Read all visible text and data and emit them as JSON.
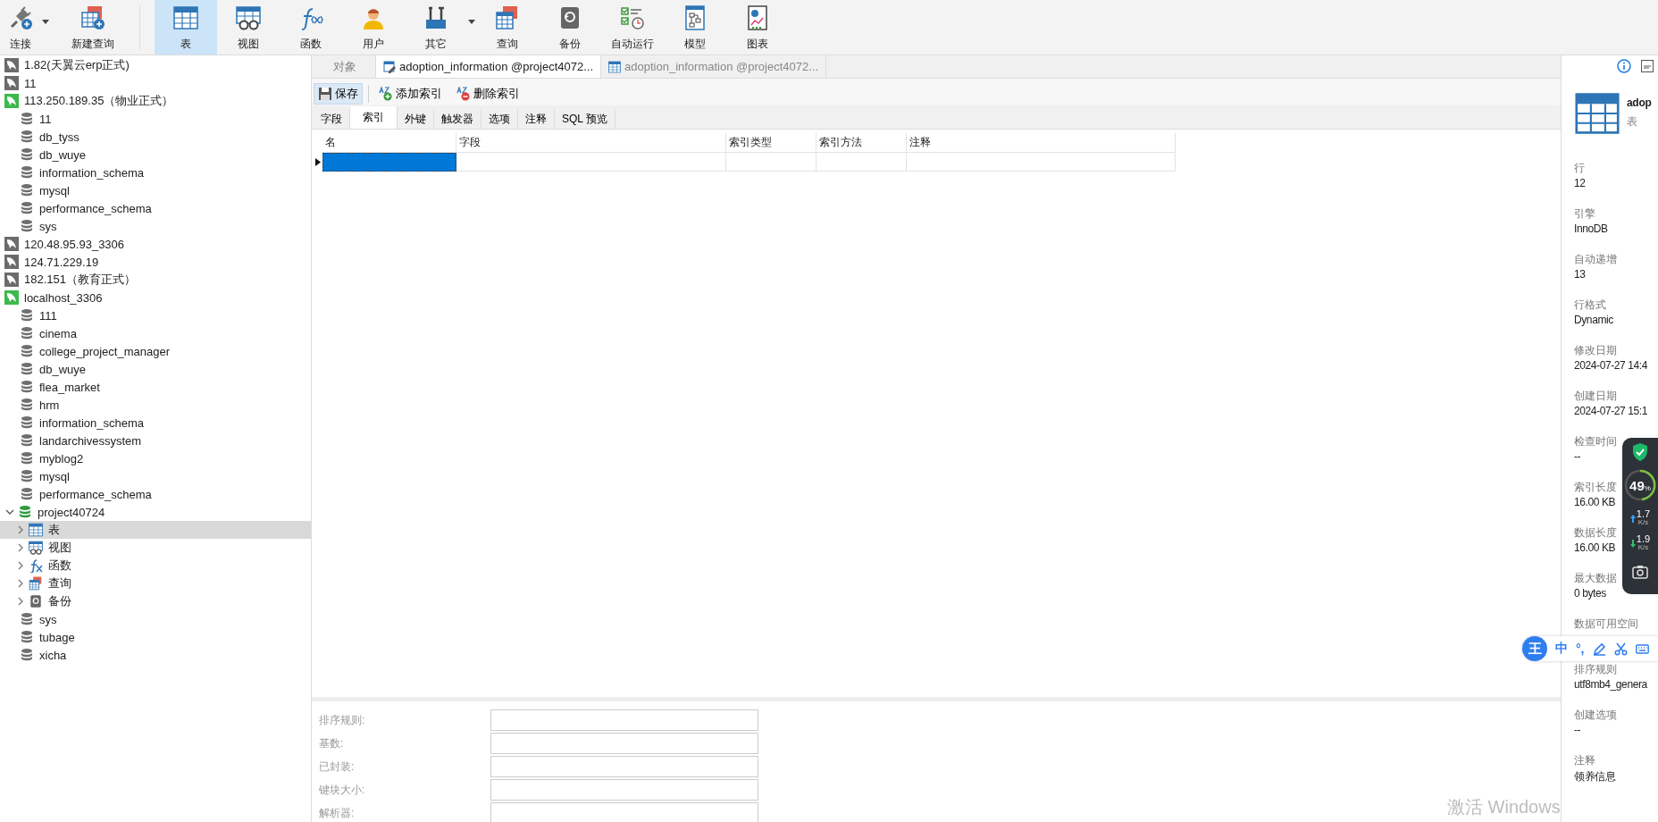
{
  "toolbar": [
    {
      "label": "连接",
      "kind": "plug",
      "dropdown": true,
      "selected": false
    },
    {
      "label": "新建查询",
      "kind": "newquery",
      "separator_after": true,
      "selected": false
    },
    {
      "label": "表",
      "kind": "table",
      "selected": true
    },
    {
      "label": "视图",
      "kind": "view",
      "selected": false
    },
    {
      "label": "函数",
      "kind": "function",
      "selected": false
    },
    {
      "label": "用户",
      "kind": "user",
      "selected": false
    },
    {
      "label": "其它",
      "kind": "tools",
      "dropdown": true,
      "selected": false
    },
    {
      "label": "查询",
      "kind": "query",
      "selected": false
    },
    {
      "label": "备份",
      "kind": "backup",
      "selected": false
    },
    {
      "label": "自动运行",
      "kind": "schedule",
      "selected": false
    },
    {
      "label": "模型",
      "kind": "model",
      "selected": false
    },
    {
      "label": "图表",
      "kind": "chart",
      "selected": false
    }
  ],
  "tree": [
    {
      "label": "1.82(天翼云erp正式)",
      "kind": "connection",
      "open": false,
      "selected": false
    },
    {
      "label": "11",
      "kind": "connection",
      "open": false,
      "selected": false
    },
    {
      "label": "113.250.189.35（物业正式）",
      "kind": "connection",
      "open": true,
      "selected": false,
      "children": [
        {
          "label": "11",
          "kind": "database",
          "open": false,
          "selected": false
        },
        {
          "label": "db_tyss",
          "kind": "database",
          "open": false,
          "selected": false
        },
        {
          "label": "db_wuye",
          "kind": "database",
          "open": false,
          "selected": false
        },
        {
          "label": "information_schema",
          "kind": "database",
          "open": false,
          "selected": false
        },
        {
          "label": "mysql",
          "kind": "database",
          "open": false,
          "selected": false
        },
        {
          "label": "performance_schema",
          "kind": "database",
          "open": false,
          "selected": false
        },
        {
          "label": "sys",
          "kind": "database",
          "open": false,
          "selected": false
        }
      ]
    },
    {
      "label": "120.48.95.93_3306",
      "kind": "connection",
      "open": false,
      "selected": false
    },
    {
      "label": "124.71.229.19",
      "kind": "connection",
      "open": false,
      "selected": false
    },
    {
      "label": "182.151（教育正式）",
      "kind": "connection",
      "open": false,
      "selected": false
    },
    {
      "label": "localhost_3306",
      "kind": "connection",
      "open": true,
      "selected": false,
      "children": [
        {
          "label": "111",
          "kind": "database",
          "open": false,
          "selected": false
        },
        {
          "label": "cinema",
          "kind": "database",
          "open": false,
          "selected": false
        },
        {
          "label": "college_project_manager",
          "kind": "database",
          "open": false,
          "selected": false
        },
        {
          "label": "db_wuye",
          "kind": "database",
          "open": false,
          "selected": false
        },
        {
          "label": "flea_market",
          "kind": "database",
          "open": false,
          "selected": false
        },
        {
          "label": "hrm",
          "kind": "database",
          "open": false,
          "selected": false
        },
        {
          "label": "information_schema",
          "kind": "database",
          "open": false,
          "selected": false
        },
        {
          "label": "landarchivessystem",
          "kind": "database",
          "open": false,
          "selected": false
        },
        {
          "label": "myblog2",
          "kind": "database",
          "open": false,
          "selected": false
        },
        {
          "label": "mysql",
          "kind": "database",
          "open": false,
          "selected": false
        },
        {
          "label": "performance_schema",
          "kind": "database",
          "open": false,
          "selected": false
        },
        {
          "label": "project40724",
          "kind": "database",
          "open": true,
          "expanded": true,
          "selected": false,
          "children": [
            {
              "label": "表",
              "kind": "tables",
              "expanded": false,
              "selected": true
            },
            {
              "label": "视图",
              "kind": "views",
              "expanded": false,
              "selected": false
            },
            {
              "label": "函数",
              "kind": "functions",
              "expanded": false,
              "selected": false
            },
            {
              "label": "查询",
              "kind": "queries",
              "expanded": false,
              "selected": false
            },
            {
              "label": "备份",
              "kind": "backups",
              "expanded": false,
              "selected": false
            }
          ]
        },
        {
          "label": "sys",
          "kind": "database",
          "open": false,
          "selected": false
        },
        {
          "label": "tubage",
          "kind": "database",
          "open": false,
          "selected": false
        },
        {
          "label": "xicha",
          "kind": "database",
          "open": false,
          "selected": false
        }
      ]
    }
  ],
  "doc_tabs": [
    {
      "label": "对象",
      "kind": "objects",
      "selected": false
    },
    {
      "label": "adoption_information @project4072...",
      "kind": "design",
      "selected": true
    },
    {
      "label": "adoption_information @project4072...",
      "kind": "table",
      "selected": false
    }
  ],
  "editor_toolbar": [
    {
      "label": "保存",
      "kind": "save",
      "hovered": true
    },
    {
      "label": "添加索引",
      "kind": "add"
    },
    {
      "label": "删除索引",
      "kind": "delete"
    }
  ],
  "sub_tabs": [
    {
      "label": "字段",
      "selected": false
    },
    {
      "label": "索引",
      "selected": true
    },
    {
      "label": "外键",
      "selected": false
    },
    {
      "label": "触发器",
      "selected": false
    },
    {
      "label": "选项",
      "selected": false
    },
    {
      "label": "注释",
      "selected": false
    },
    {
      "label": "SQL 预览",
      "selected": false
    }
  ],
  "grid": {
    "columns": [
      "名",
      "字段",
      "索引类型",
      "索引方法",
      "注释"
    ],
    "rows": [
      {
        "current": true,
        "cells": [
          {
            "selected": true
          },
          {
            "selected": false
          },
          {
            "selected": false
          },
          {
            "selected": false
          },
          {
            "selected": false
          }
        ]
      }
    ]
  },
  "index_options": [
    {
      "label": "排序规则:"
    },
    {
      "label": "基数:"
    },
    {
      "label": "已封装:"
    },
    {
      "label": "键块大小:"
    },
    {
      "label": "解析器:"
    }
  ],
  "info_panel": {
    "name": "adop",
    "type": "表",
    "properties": [
      {
        "label": "行",
        "value": "12"
      },
      {
        "label": "引擎",
        "value": "InnoDB"
      },
      {
        "label": "自动递增",
        "value": "13"
      },
      {
        "label": "行格式",
        "value": "Dynamic"
      },
      {
        "label": "修改日期",
        "value": "2024-07-27 14:4"
      },
      {
        "label": "创建日期",
        "value": "2024-07-27 15:1"
      },
      {
        "label": "检查时间",
        "value": "--"
      },
      {
        "label": "索引长度",
        "value": "16.00 KB"
      },
      {
        "label": "数据长度",
        "value": "16.00 KB"
      },
      {
        "label": "最大数据",
        "value": "0 bytes"
      },
      {
        "label": "数据可用空间"
      },
      {
        "label": "排序规则",
        "value": "utf8mb4_genera"
      },
      {
        "label": "创建选项",
        "value": "--"
      },
      {
        "label": "注释",
        "value": "领养信息"
      }
    ]
  },
  "security_widget": {
    "percent": "49",
    "unit": "%",
    "upload": "1.7",
    "upload_unit": "K/s",
    "download": "1.9",
    "download_unit": "K/s"
  },
  "ime_bar": {
    "logo": "王",
    "mode": "中",
    "punct": "°,"
  },
  "activation_notice": "激活 Windows"
}
